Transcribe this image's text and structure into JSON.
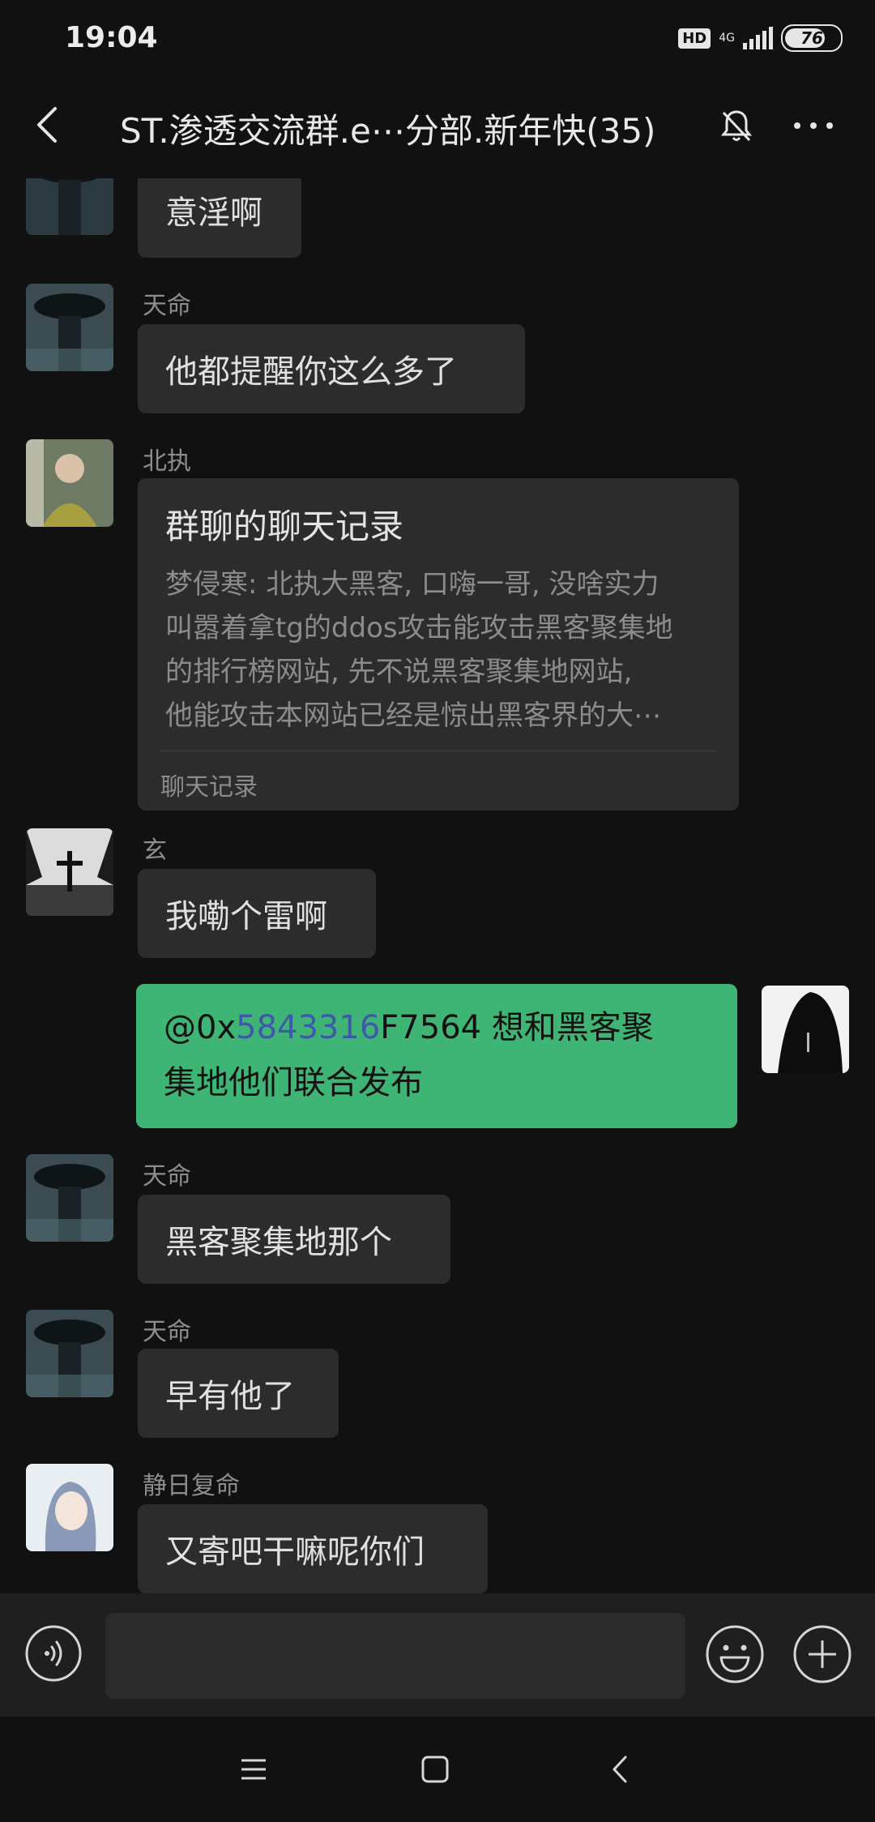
{
  "status_bar": {
    "time": "19:04",
    "hd": "HD",
    "network": "4G",
    "battery": "76",
    "battery_level": 0.76
  },
  "header": {
    "title": "ST.渗透交流群.e⋯分部.新年快(35)"
  },
  "messages": {
    "m0": {
      "text": "意淫啊"
    },
    "m1": {
      "sender": "天命",
      "text": "他都提醒你这么多了"
    },
    "m2": {
      "sender": "北执",
      "card_title": "群聊的聊天记录",
      "line1": "梦侵寒: 北执大黑客, 口嗨一哥, 没啥实力",
      "line2": "叫嚣着拿tg的ddos攻击能攻击黑客聚集地",
      "line3": "的排行榜网站, 先不说黑客聚集地网站,",
      "line4": "他能攻击本网站已经是惊出黑客界的大⋯",
      "footer": "聊天记录"
    },
    "m3": {
      "sender": "玄",
      "text": "我嘞个雷啊"
    },
    "m4": {
      "mention_prefix": "@0x",
      "mention_highlight": "5843316",
      "mention_suffix": "F7564",
      "line1_rest": "想和黑客聚",
      "line2": "集地他们联合发布"
    },
    "m5": {
      "sender": "天命",
      "text": "黑客聚集地那个"
    },
    "m6": {
      "sender": "天命",
      "text": "早有他了"
    },
    "m7": {
      "sender": "静日复命",
      "text": "又寄吧干嘛呢你们"
    }
  },
  "colors": {
    "background": "#111111",
    "bubble": "#2c2c2c",
    "my_bubble": "#3eb575",
    "mention": "#3d5aa8"
  },
  "icons": {
    "back": "chevron-left-icon",
    "mute": "bell-off-icon",
    "more": "more-icon",
    "voice": "voice-icon",
    "emoji": "emoji-icon",
    "plus": "plus-circle-icon",
    "menu": "menu-icon",
    "home": "home-icon",
    "nav_back": "nav-back-icon"
  }
}
